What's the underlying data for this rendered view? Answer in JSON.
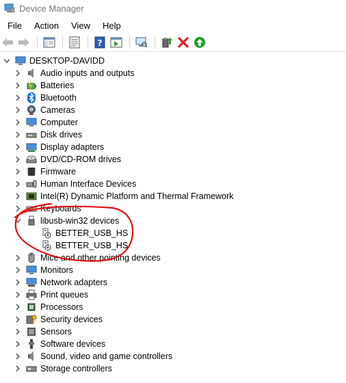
{
  "window": {
    "title": "Device Manager"
  },
  "menu": {
    "items": [
      "File",
      "Action",
      "View",
      "Help"
    ]
  },
  "toolbar": {
    "buttons": [
      {
        "icon": "back-arrow-icon"
      },
      {
        "icon": "forward-arrow-icon"
      },
      {
        "icon": "show-hide-console-tree-icon"
      },
      {
        "icon": "properties-icon"
      },
      {
        "icon": "help-icon"
      },
      {
        "icon": "action-pane-icon"
      },
      {
        "icon": "scan-hardware-changes-icon"
      },
      {
        "icon": "update-driver-icon"
      },
      {
        "icon": "uninstall-device-icon"
      },
      {
        "icon": "enable-device-icon"
      }
    ]
  },
  "tree": {
    "root": "DESKTOP-DAVIDD",
    "categories": [
      {
        "label": "Audio inputs and outputs",
        "icon": "speaker-icon"
      },
      {
        "label": "Batteries",
        "icon": "battery-icon"
      },
      {
        "label": "Bluetooth",
        "icon": "bluetooth-icon"
      },
      {
        "label": "Cameras",
        "icon": "camera-icon"
      },
      {
        "label": "Computer",
        "icon": "computer-icon"
      },
      {
        "label": "Disk drives",
        "icon": "disk-drive-icon"
      },
      {
        "label": "Display adapters",
        "icon": "display-adapter-icon"
      },
      {
        "label": "DVD/CD-ROM drives",
        "icon": "dvd-drive-icon"
      },
      {
        "label": "Firmware",
        "icon": "firmware-icon"
      },
      {
        "label": "Human Interface Devices",
        "icon": "hid-icon"
      },
      {
        "label": "Intel(R) Dynamic Platform and Thermal Framework",
        "icon": "thermal-framework-icon"
      },
      {
        "label": "Keyboards",
        "icon": "keyboard-icon"
      },
      {
        "label": "libusb-win32 devices",
        "icon": "usb-icon",
        "expanded": true,
        "children": [
          {
            "label": "BETTER_USB_HS",
            "icon": "usb-device-warning-icon"
          },
          {
            "label": "BETTER_USB_HS",
            "icon": "usb-device-warning-icon"
          }
        ]
      },
      {
        "label": "Mice and other pointing devices",
        "icon": "mouse-icon"
      },
      {
        "label": "Monitors",
        "icon": "monitor-icon"
      },
      {
        "label": "Network adapters",
        "icon": "network-adapter-icon"
      },
      {
        "label": "Print queues",
        "icon": "printer-icon"
      },
      {
        "label": "Processors",
        "icon": "processor-icon"
      },
      {
        "label": "Security devices",
        "icon": "security-key-icon"
      },
      {
        "label": "Sensors",
        "icon": "sensor-icon"
      },
      {
        "label": "Software devices",
        "icon": "software-device-icon"
      },
      {
        "label": "Sound, video and game controllers",
        "icon": "sound-controller-icon"
      },
      {
        "label": "Storage controllers",
        "icon": "storage-controller-icon"
      }
    ]
  },
  "annotation": {
    "color": "#e01010"
  }
}
